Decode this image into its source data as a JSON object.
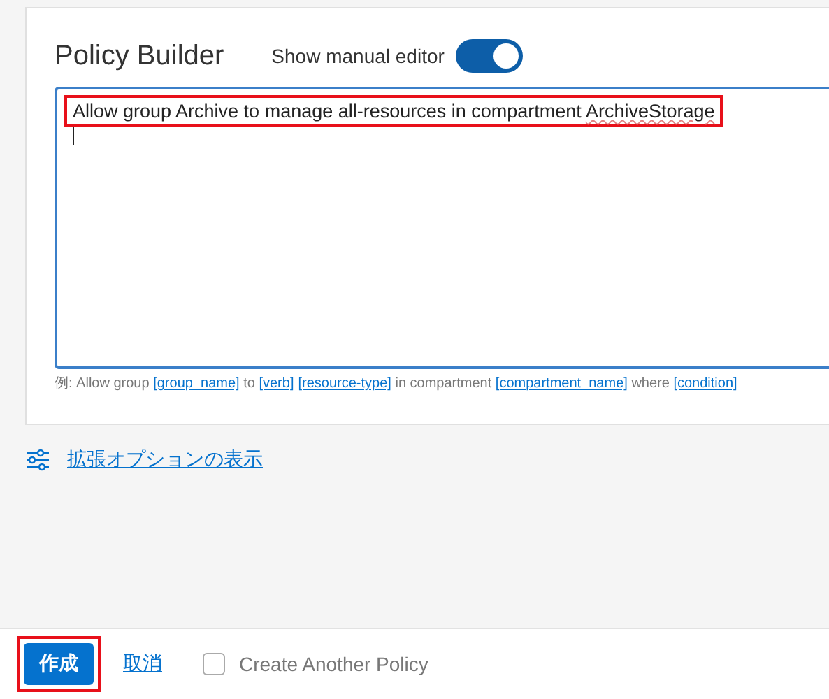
{
  "policy_builder": {
    "title": "Policy Builder",
    "manual_editor_toggle": {
      "label": "Show manual editor",
      "on": true
    },
    "editor": {
      "value": "Allow group Archive to manage all-resources in compartment ArchiveStorage",
      "highlighted": true
    },
    "hint": [
      {
        "kind": "text",
        "text": "例: Allow group "
      },
      {
        "kind": "link",
        "text": "[group_name]"
      },
      {
        "kind": "text",
        "text": " to "
      },
      {
        "kind": "link",
        "text": "[verb]"
      },
      {
        "kind": "link",
        "text": "[resource-type]"
      },
      {
        "kind": "text",
        "text": " in compartment "
      },
      {
        "kind": "link",
        "text": "[compartment_name]"
      },
      {
        "kind": "text",
        "text": " where "
      },
      {
        "kind": "link",
        "text": "[condition]"
      }
    ]
  },
  "advanced_options_link": "拡張オプションの表示",
  "footer": {
    "create_button": {
      "label": "作成",
      "highlighted": true
    },
    "cancel_link": "取消",
    "create_another": {
      "label": "Create Another Policy",
      "checked": false
    }
  }
}
